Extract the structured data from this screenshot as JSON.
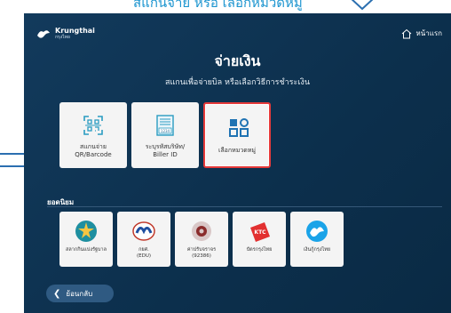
{
  "top_caption": "สแกนจ่าย หรือ เลือกหมวดหมู่",
  "header": {
    "logo_name": "Krungthai",
    "logo_sub": "กรุงไทย",
    "home_label": "หน้าแรก"
  },
  "page": {
    "title": "จ่ายเงิน",
    "subtitle": "สแกนเพื่อจ่ายบิล หรือเลือกวิธีการชำระเงิน"
  },
  "options": [
    {
      "line1": "สแกนจ่าย",
      "line2": "QR/Barcode",
      "icon": "qr-scan-icon"
    },
    {
      "line1": "ระบุรหัสบริษัท/",
      "line2": "Biller ID",
      "icon": "biller-id-icon",
      "icon_text": "1234"
    },
    {
      "line1": "เลือกหมวดหมู่",
      "line2": "",
      "icon": "category-grid-icon",
      "selected": true
    }
  ],
  "popular": {
    "title": "ยอดนิยม",
    "items": [
      {
        "line1": "สลากกินแบ่งรัฐบาล",
        "line2": "",
        "icon": "lottery-icon"
      },
      {
        "line1": "กยศ.",
        "line2": "(EDU)",
        "icon": "student-loan-icon"
      },
      {
        "line1": "ค่าปรับจราจร",
        "line2": "(92386)",
        "icon": "traffic-fine-icon"
      },
      {
        "line1": "บัตรกรุงไทย",
        "line2": "",
        "icon": "ktc-card-icon",
        "badge": "KTC"
      },
      {
        "line1": "เงินกู้กรุงไทย",
        "line2": "",
        "icon": "krungthai-loan-icon"
      }
    ]
  },
  "back_label": "ย้อนกลับ",
  "colors": {
    "background": "#0f3556",
    "selected_border": "#e53a3a",
    "accent": "#1b94cf"
  }
}
